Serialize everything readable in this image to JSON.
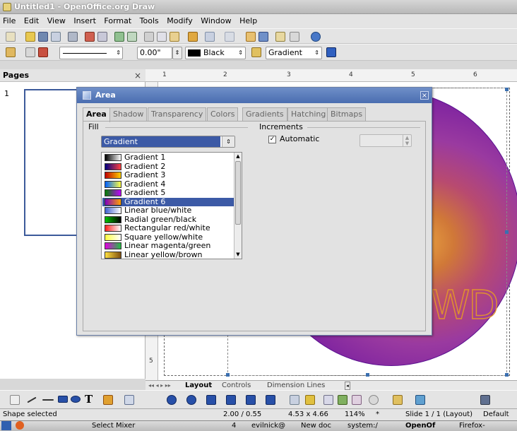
{
  "window": {
    "title": "Untitled1 - OpenOffice.org Draw"
  },
  "menubar": [
    "File",
    "Edit",
    "View",
    "Insert",
    "Format",
    "Tools",
    "Modify",
    "Window",
    "Help"
  ],
  "toolbar2": {
    "line_width": "0.00\"",
    "line_color": "Black",
    "area_style": "Gradient"
  },
  "pages_panel": {
    "title": "Pages",
    "page_number": "1"
  },
  "ruler": {
    "h_ticks": [
      "1",
      "2",
      "3",
      "4",
      "5",
      "6"
    ],
    "v_ticks": [
      "5"
    ]
  },
  "dialog": {
    "title": "Area",
    "tabs": [
      "Area",
      "Shadow",
      "Transparency",
      "Colors",
      "Gradients",
      "Hatching",
      "Bitmaps"
    ],
    "fill_label": "Fill",
    "fill_value": "Gradient",
    "increments_label": "Increments",
    "automatic_label": "Automatic",
    "automatic_checked": true,
    "gradients": [
      {
        "name": "Gradient 1",
        "c1": "#000000",
        "c2": "#ffffff"
      },
      {
        "name": "Gradient 2",
        "c1": "#000080",
        "c2": "#ff4040"
      },
      {
        "name": "Gradient 3",
        "c1": "#c00000",
        "c2": "#ffd000"
      },
      {
        "name": "Gradient 4",
        "c1": "#0060ff",
        "c2": "#ffff40"
      },
      {
        "name": "Gradient 5",
        "c1": "#008000",
        "c2": "#c000ff"
      },
      {
        "name": "Gradient 6",
        "c1": "#8000c0",
        "c2": "#ffa000"
      },
      {
        "name": "Linear blue/white",
        "c1": "#4060d0",
        "c2": "#ffffff"
      },
      {
        "name": "Radial green/black",
        "c1": "#00c000",
        "c2": "#000000"
      },
      {
        "name": "Rectangular red/white",
        "c1": "#ff2020",
        "c2": "#ffffff"
      },
      {
        "name": "Square yellow/white",
        "c1": "#ffff40",
        "c2": "#ffffff"
      },
      {
        "name": "Linear magenta/green",
        "c1": "#e000e0",
        "c2": "#20c040"
      },
      {
        "name": "Linear yellow/brown",
        "c1": "#ffe040",
        "c2": "#805010"
      }
    ],
    "selected_gradient": "Gradient 6"
  },
  "canvas_text": {
    "big_text": "WD"
  },
  "layout_tabs": [
    "Layout",
    "Controls",
    "Dimension Lines"
  ],
  "statusbar": {
    "state": "Shape selected",
    "position": "2.00 / 0.55",
    "size": "4.53 x 4.66",
    "zoom": "114%",
    "modified": "*",
    "slide": "Slide 1 / 1 (Layout)",
    "style": "Default"
  },
  "taskbar": {
    "items": [
      "Select Mixer",
      "4",
      "evilnick@",
      "New doc",
      "system:/",
      "OpenOf",
      "Firefox-"
    ]
  }
}
